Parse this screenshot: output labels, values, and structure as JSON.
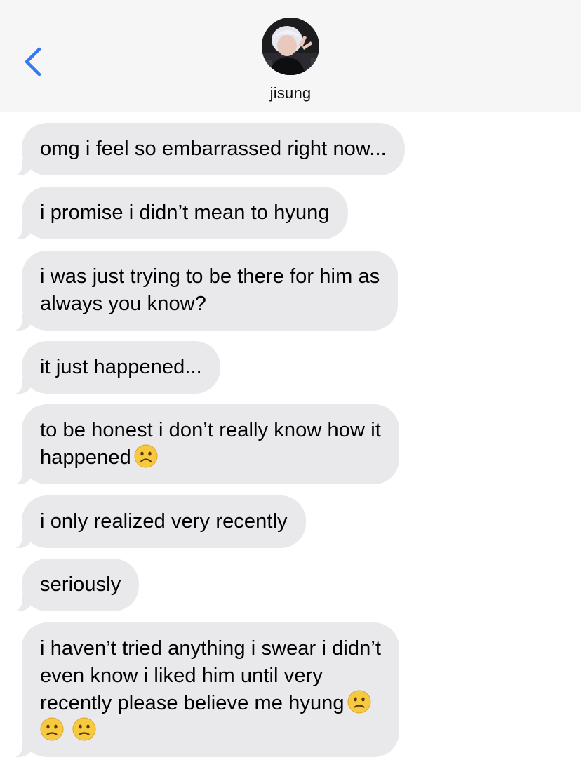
{
  "header": {
    "contact_name": "jisung",
    "back_icon": "chevron-left-icon",
    "accent_color": "#3478f6"
  },
  "messages": [
    {
      "text": "omg i feel so embarrassed right now...",
      "emoji_count": 0,
      "emoji": ""
    },
    {
      "text": "i promise i didn’t mean to hyung",
      "emoji_count": 0,
      "emoji": ""
    },
    {
      "text": "i was just trying to be there for him as\nalways you know?",
      "emoji_count": 0,
      "emoji": ""
    },
    {
      "text": "it just happened...",
      "emoji_count": 0,
      "emoji": ""
    },
    {
      "text": "to be honest i don’t really know how it\nhappened",
      "emoji_count": 1,
      "emoji": "frowning-face-icon"
    },
    {
      "text": "i only realized very recently",
      "emoji_count": 0,
      "emoji": ""
    },
    {
      "text": "seriously",
      "emoji_count": 0,
      "emoji": ""
    },
    {
      "text": "i haven’t tried anything i swear i didn’t\neven know i liked him until very\nrecently please believe me hyung",
      "emoji_count": 3,
      "emoji": "slightly-frowning-face-icon"
    }
  ],
  "colors": {
    "incoming_bubble": "#e9e9eb",
    "header_background": "#f6f6f6"
  }
}
